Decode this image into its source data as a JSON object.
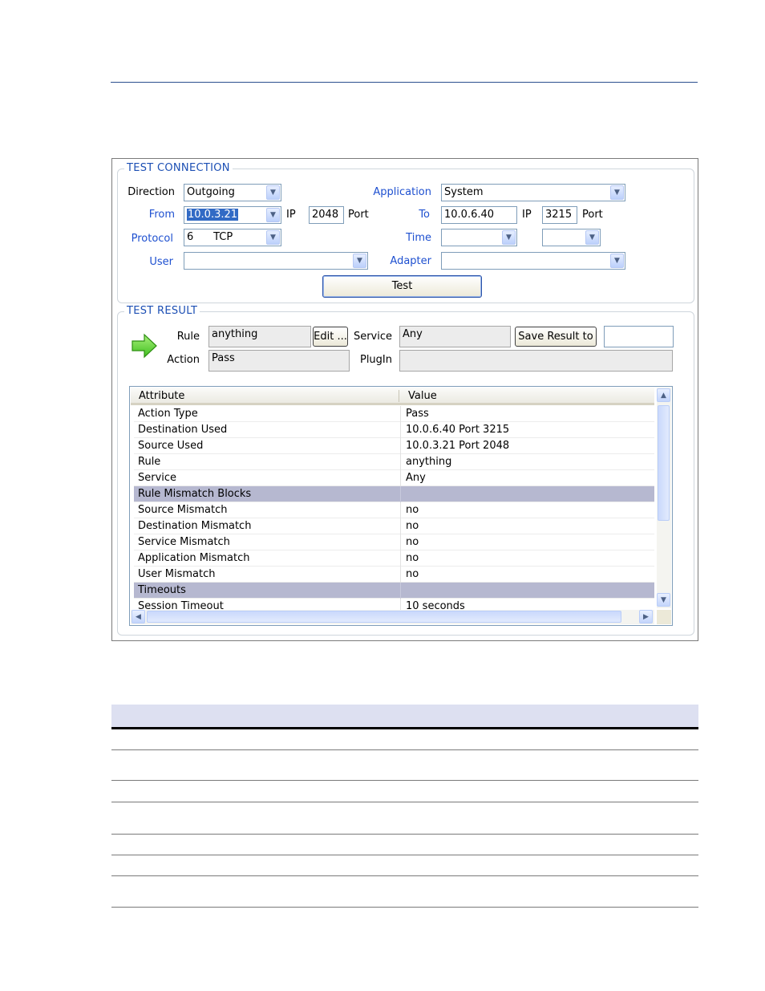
{
  "test_connection": {
    "title": "TEST CONNECTION",
    "direction_label": "Direction",
    "direction_value": "Outgoing",
    "from_label": "From",
    "from_ip": "10.0.3.21",
    "ip_label": "IP",
    "from_port": "2048",
    "port_label": "Port",
    "protocol_label": "Protocol",
    "protocol_value": "6      TCP",
    "user_label": "User",
    "user_value": "",
    "application_label": "Application",
    "application_value": "System",
    "to_label": "To",
    "to_ip": "10.0.6.40",
    "to_port": "3215",
    "time_label": "Time",
    "time_value_1": "",
    "time_value_2": "",
    "adapter_label": "Adapter",
    "adapter_value": "",
    "test_button": "Test"
  },
  "test_result": {
    "title": "TEST RESULT",
    "rule_label": "Rule",
    "rule_value": "anything",
    "edit_button": "Edit ...",
    "service_label": "Service",
    "service_value": "Any",
    "save_button": "Save Result  to",
    "save_value": "",
    "action_label": "Action",
    "action_value": "Pass",
    "plugin_label": "PlugIn",
    "plugin_value": ""
  },
  "grid": {
    "col_attribute": "Attribute",
    "col_value": "Value",
    "rows": [
      {
        "attr": "Action Type",
        "value": "Pass",
        "group": false
      },
      {
        "attr": "Destination Used",
        "value": "10.0.6.40 Port 3215",
        "group": false
      },
      {
        "attr": "Source Used",
        "value": "10.0.3.21 Port 2048",
        "group": false
      },
      {
        "attr": "Rule",
        "value": "anything",
        "group": false
      },
      {
        "attr": "Service",
        "value": "Any",
        "group": false
      },
      {
        "attr": "Rule Mismatch Blocks",
        "value": "",
        "group": true
      },
      {
        "attr": "Source Mismatch",
        "value": "no",
        "group": false
      },
      {
        "attr": "Destination Mismatch",
        "value": "no",
        "group": false
      },
      {
        "attr": "Service Mismatch",
        "value": "no",
        "group": false
      },
      {
        "attr": "Application Mismatch",
        "value": "no",
        "group": false
      },
      {
        "attr": "User Mismatch",
        "value": "no",
        "group": false
      },
      {
        "attr": "Timeouts",
        "value": "",
        "group": true
      },
      {
        "attr": "Session Timeout",
        "value": "10 seconds",
        "group": false
      }
    ]
  },
  "icons": {
    "result_arrow": "green-right-arrow-icon",
    "dropdown": "chevron-down-icon",
    "scroll_up": "scroll-up-icon",
    "scroll_down": "scroll-down-icon",
    "scroll_left": "scroll-left-icon",
    "scroll_right": "scroll-right-icon"
  },
  "colors": {
    "label_blue": "#1e50d0",
    "group_title": "#1c4fb4",
    "group_row": "#b6b8d0",
    "table_header": "#dde0f1"
  }
}
